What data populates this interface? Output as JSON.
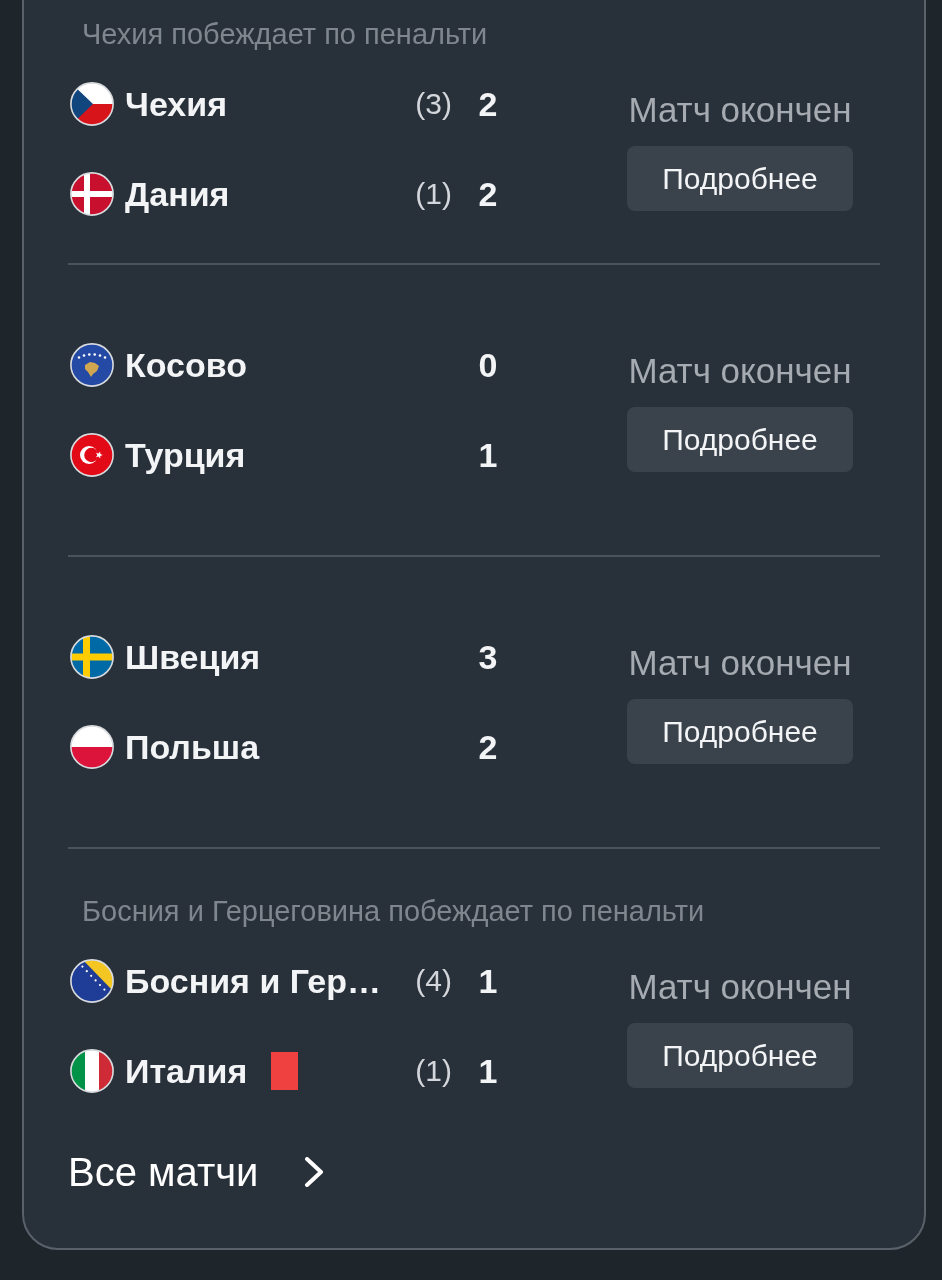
{
  "matches": [
    {
      "note": "Чехия побеждает по пенальти",
      "teams": [
        {
          "name": "Чехия",
          "penalty": "(3)",
          "score": "2",
          "red_card": false
        },
        {
          "name": "Дания",
          "penalty": "(1)",
          "score": "2",
          "red_card": false
        }
      ],
      "status": "Матч окончен",
      "button": "Подробнее"
    },
    {
      "teams": [
        {
          "name": "Косово",
          "score": "0",
          "red_card": false
        },
        {
          "name": "Турция",
          "score": "1",
          "red_card": false
        }
      ],
      "status": "Матч окончен",
      "button": "Подробнее"
    },
    {
      "teams": [
        {
          "name": "Швеция",
          "score": "3",
          "red_card": false
        },
        {
          "name": "Польша",
          "score": "2",
          "red_card": false
        }
      ],
      "status": "Матч окончен",
      "button": "Подробнее"
    },
    {
      "note": "Босния и Герцеговина побеждает по пенальти",
      "teams": [
        {
          "name": "Босния и Гер…",
          "penalty": "(4)",
          "score": "1",
          "red_card": false
        },
        {
          "name": "Италия",
          "penalty": "(1)",
          "score": "1",
          "red_card": true
        }
      ],
      "status": "Матч окончен",
      "button": "Подробнее"
    }
  ],
  "all_matches_link": "Все матчи"
}
